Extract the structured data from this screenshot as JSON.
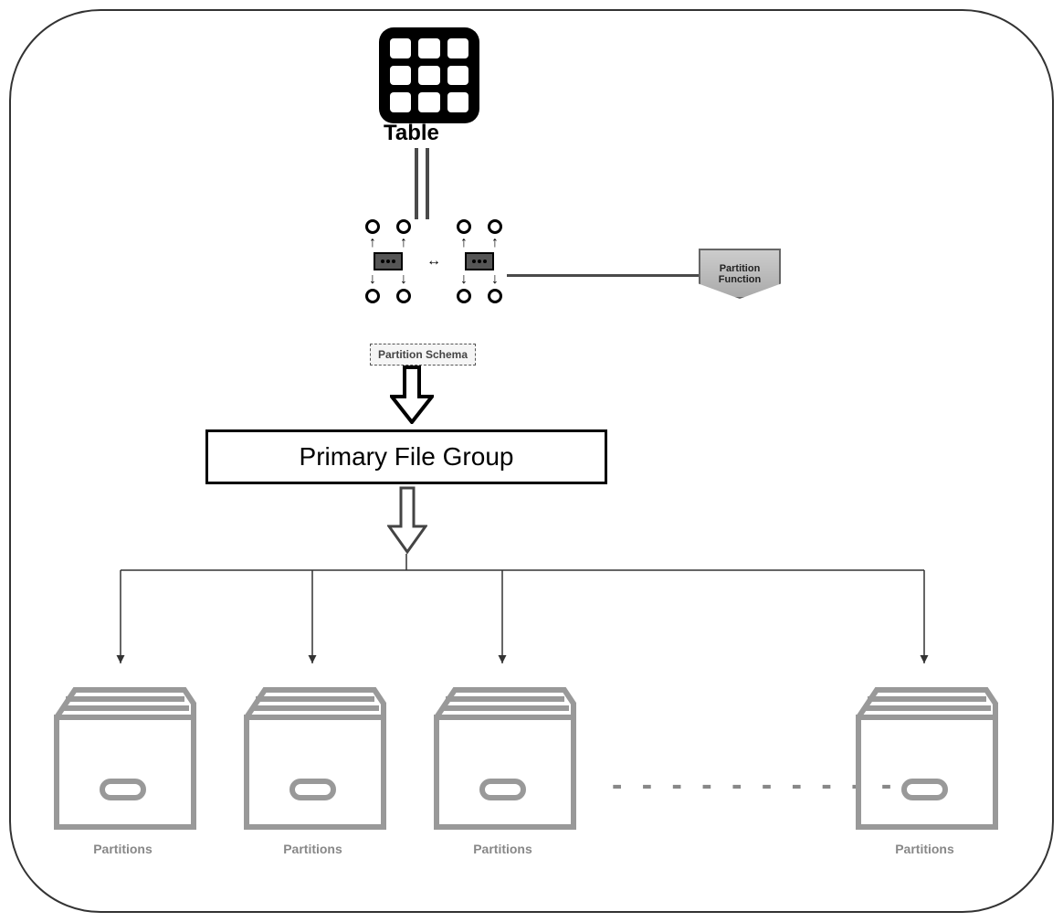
{
  "labels": {
    "table": "Table",
    "partition_schema": "Partition Schema",
    "partition_function": "Partition\nFunction",
    "primary_file_group": "Primary File Group",
    "partitions": "Partitions",
    "ellipsis": "- - - - - - - - - -"
  },
  "partition_count_visible": 4
}
